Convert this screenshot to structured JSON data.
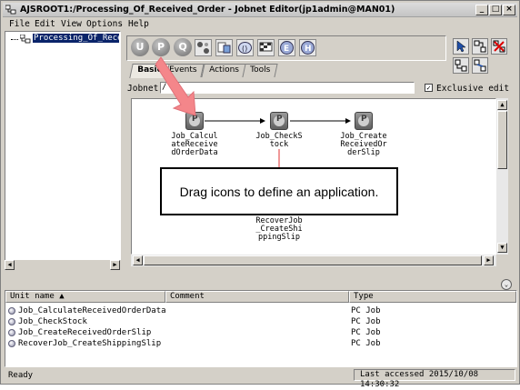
{
  "window": {
    "title": "AJSROOT1:/Processing_Of_Received_Order - Jobnet Editor(jp1admin@MAN01)"
  },
  "menu": [
    "File",
    "Edit",
    "View",
    "Options",
    "Help"
  ],
  "tree": {
    "selected_item": "Processing_Of_Recei"
  },
  "toolbar": {
    "icons": [
      "U",
      "P",
      "Q",
      "",
      "",
      "",
      "",
      "",
      ""
    ]
  },
  "tabs": [
    "Basic",
    "Events",
    "Actions",
    "Tools"
  ],
  "jobnet": {
    "label": "Jobnet :",
    "value": "/",
    "exclusive_edit_label": "Exclusive edit",
    "exclusive_edit_checked": true
  },
  "canvas": {
    "jobs": [
      {
        "label": "Job_Calcul\nateReceive\ndOrderData"
      },
      {
        "label": "Job_CheckS\ntock"
      },
      {
        "label": "Job_Create\nReceivedOr\nderSlip"
      },
      {
        "label": "RecoverJob\n_CreateShi\nppingSlip"
      }
    ],
    "callout": "Drag icons to define an application."
  },
  "list": {
    "columns": [
      "Unit name",
      "Comment",
      "Type"
    ],
    "rows": [
      {
        "name": "Job_CalculateReceivedOrderData",
        "comment": "",
        "type": "PC Job"
      },
      {
        "name": "Job_CheckStock",
        "comment": "",
        "type": "PC Job"
      },
      {
        "name": "Job_CreateReceivedOrderSlip",
        "comment": "",
        "type": "PC Job"
      },
      {
        "name": "RecoverJob_CreateShippingSlip",
        "comment": "",
        "type": "PC Job"
      }
    ]
  },
  "status": {
    "left": "Ready",
    "right": "Last accessed 2015/10/08 14:30:32"
  },
  "colors": {
    "selection": "#0a246a",
    "arrow": "#f4868a",
    "chrome": "#d4d0c8"
  }
}
